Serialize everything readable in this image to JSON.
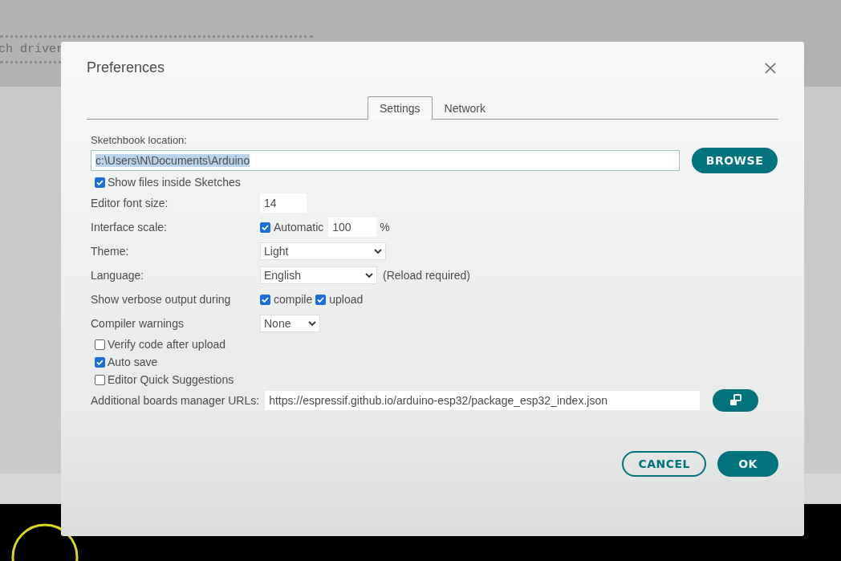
{
  "background": {
    "text": "ch driver"
  },
  "dialog": {
    "title": "Preferences",
    "tabs": [
      {
        "label": "Settings",
        "selected": true
      },
      {
        "label": "Network",
        "selected": false
      }
    ],
    "sketchbook": {
      "label": "Sketchbook location:",
      "value": "c:\\Users\\N\\Documents\\Arduino",
      "highlighted": true,
      "button": "BROWSE"
    },
    "settings": [
      {
        "kind": "checkbox",
        "label": "Show files inside Sketches",
        "checked": true
      },
      {
        "kind": "number",
        "label": "Editor font size:",
        "value": "14"
      },
      {
        "kind": "scale",
        "label": "Interface scale:",
        "option": {
          "label": "Automatic",
          "checked": true
        },
        "value": "100",
        "unit": "%"
      },
      {
        "kind": "select",
        "label": "Theme:",
        "value": "Light"
      },
      {
        "kind": "select",
        "label": "Language:",
        "value": "English",
        "note": "(Reload required)"
      },
      {
        "kind": "checks",
        "label": "Show verbose output during",
        "options": [
          {
            "label": "compile",
            "checked": true
          },
          {
            "label": "upload",
            "checked": true
          }
        ]
      },
      {
        "kind": "select",
        "label": "Compiler warnings",
        "value": "None"
      },
      {
        "kind": "checkbox",
        "label": "Verify code after upload",
        "checked": false
      },
      {
        "kind": "checkbox",
        "label": "Auto save",
        "checked": true
      },
      {
        "kind": "checkbox",
        "label": "Editor Quick Suggestions",
        "checked": false
      },
      {
        "kind": "url",
        "label": "Additional boards manager URLs:",
        "value": "https://espressif.github.io/arduino-esp32/package_esp32_index.json"
      }
    ],
    "buttons": [
      {
        "label": "CANCEL",
        "kind": "outline"
      },
      {
        "label": "OK",
        "kind": "filled"
      }
    ]
  }
}
